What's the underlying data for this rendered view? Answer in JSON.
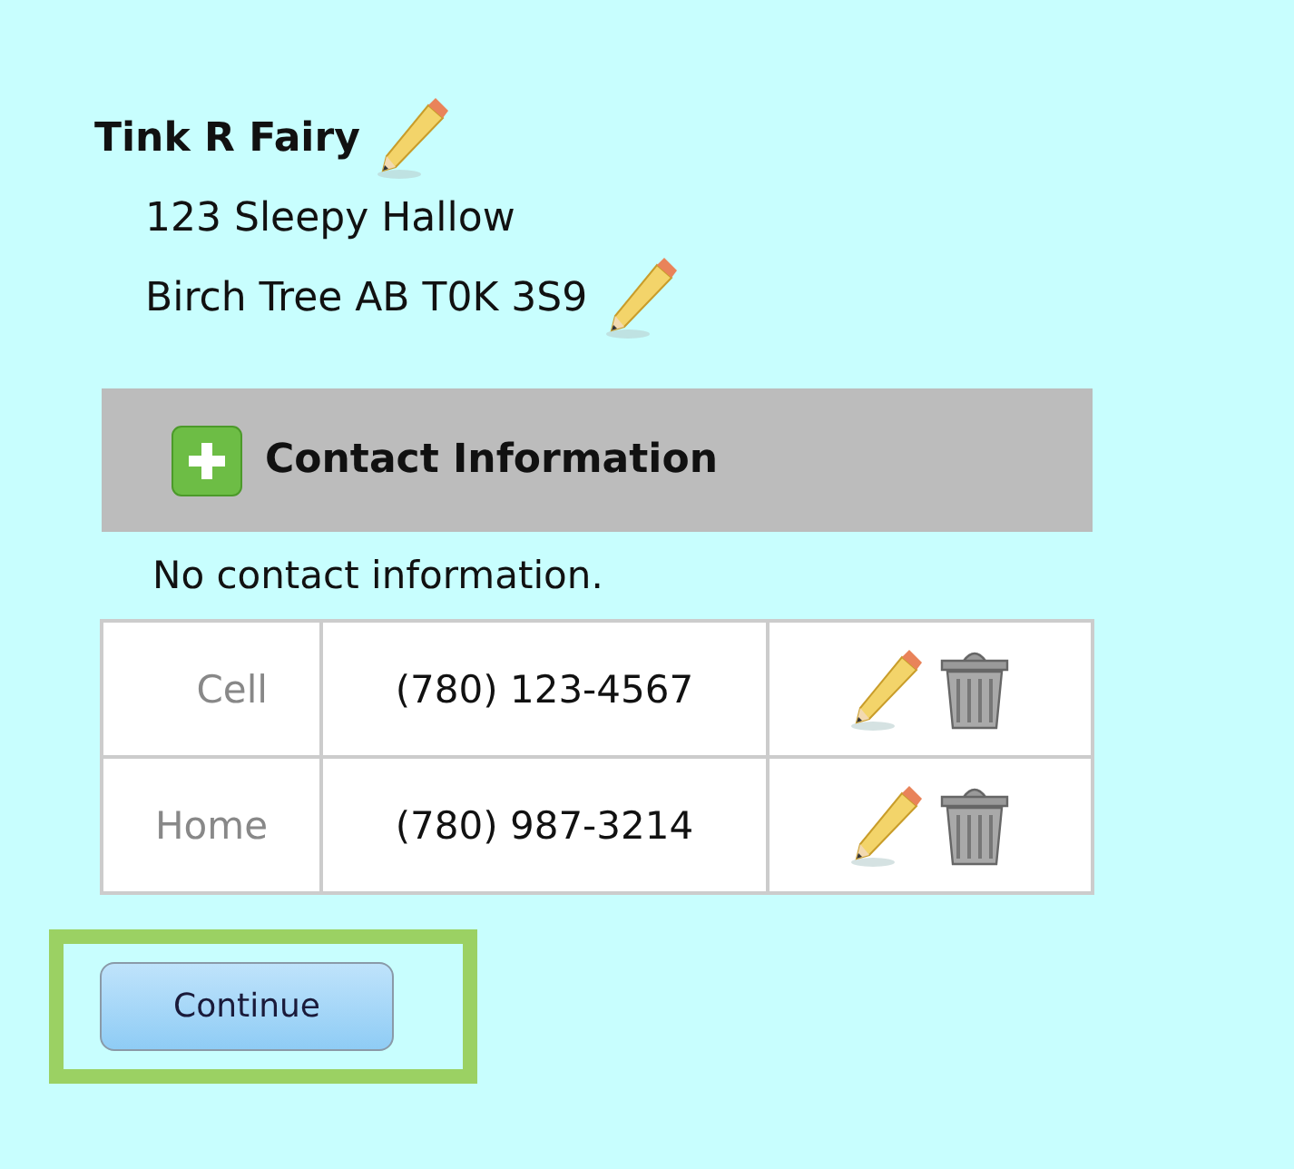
{
  "person": {
    "name": "Tink R Fairy",
    "address_lines": [
      "123 Sleepy Hallow",
      "Birch Tree AB T0K 3S9"
    ]
  },
  "contact_table": {
    "title": "Contact Information",
    "empty_message": "No contact information.",
    "rows": [
      {
        "type": "Cell",
        "number": "(780) 123-4567"
      },
      {
        "type": "Home",
        "number": "(780) 987-3214"
      }
    ]
  },
  "continue_button": {
    "label": "Continue",
    "highlighted": true
  }
}
